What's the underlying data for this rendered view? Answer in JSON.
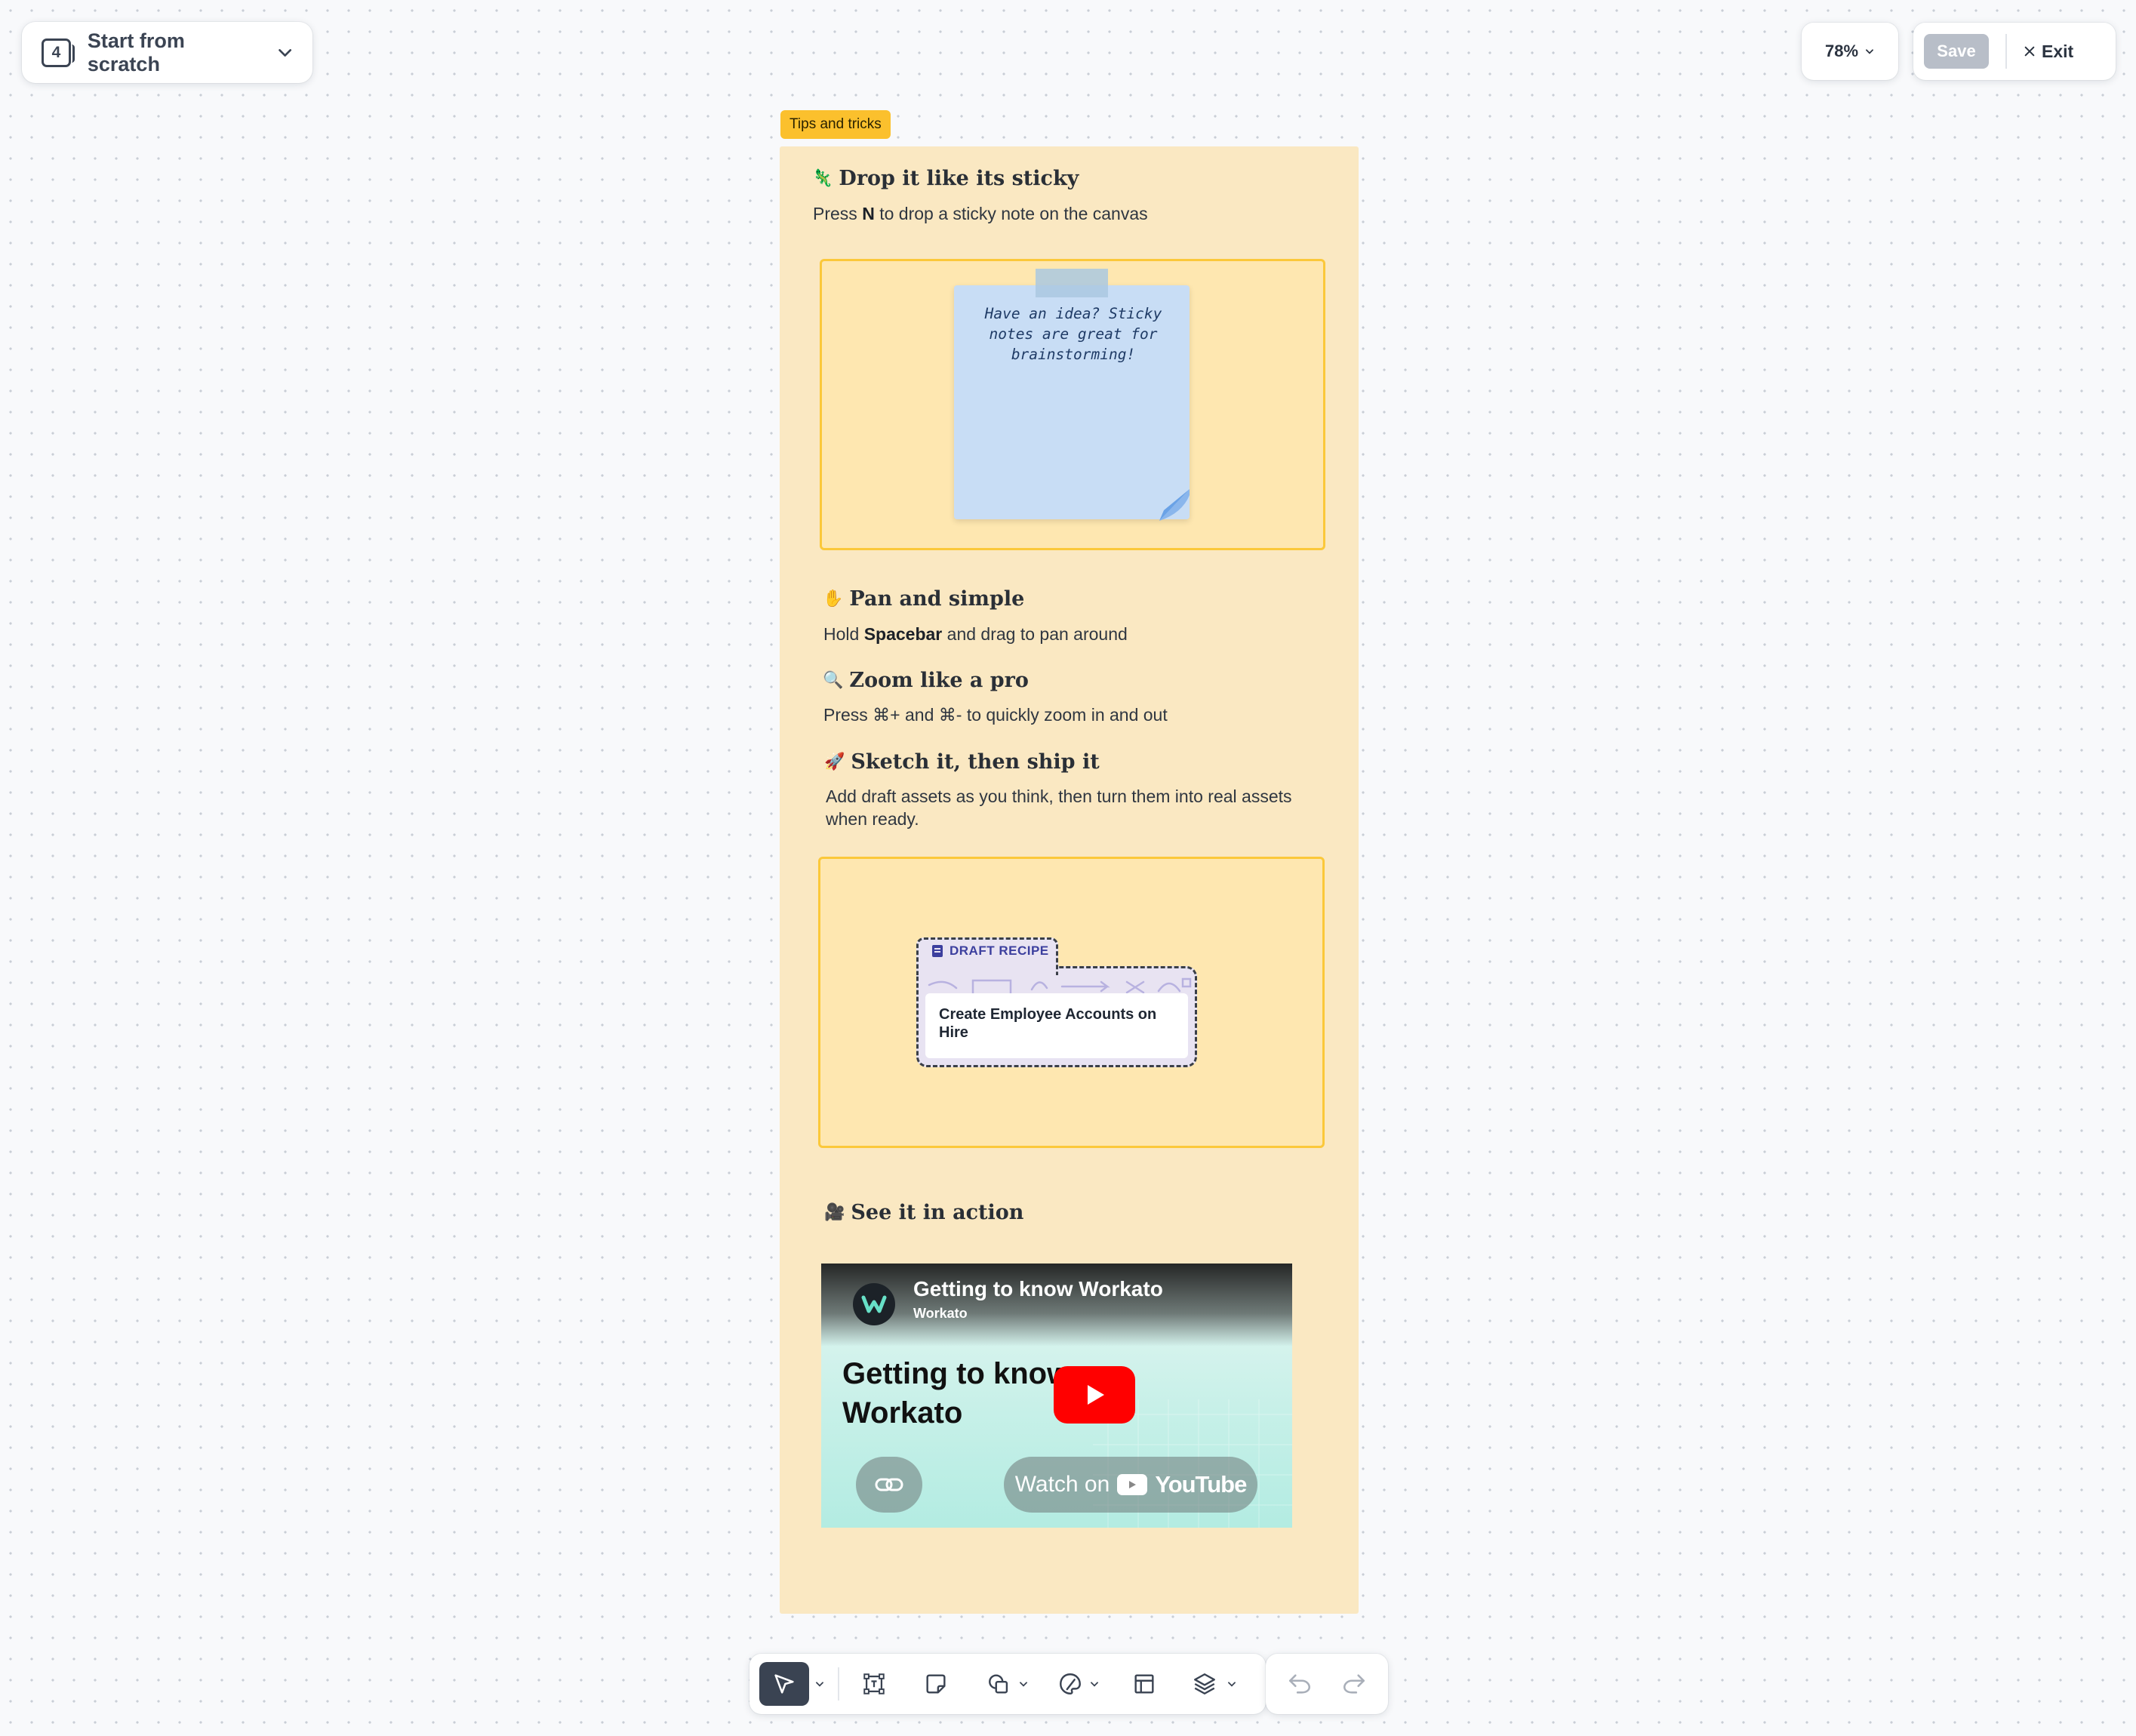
{
  "header": {
    "scope_badge": "4",
    "scope_label": "Start from scratch",
    "zoom_label": "78%",
    "save_label": "Save",
    "exit_label": "Exit"
  },
  "note": {
    "tag": "Tips and tricks",
    "sections": [
      {
        "emoji": "🦎",
        "title": "Drop it like its sticky",
        "desc_pre": "Press ",
        "desc_key": "N",
        "desc_post": " to drop a sticky note on the canvas"
      },
      {
        "emoji": "✋",
        "title": "Pan and simple",
        "desc_pre": "Hold ",
        "desc_key": "Spacebar",
        "desc_post": " and drag to pan around"
      },
      {
        "emoji": "🔍",
        "title": "Zoom like a pro",
        "desc": "Press ⌘+ and ⌘- to quickly zoom in and out"
      },
      {
        "emoji": "🚀",
        "title": "Sketch it, then ship it",
        "desc": "Add draft assets as you think, then turn them into real assets when ready."
      },
      {
        "emoji": "🎥",
        "title": "See it in action"
      }
    ],
    "sticky_text": "Have an idea? Sticky notes are great for brainstorming!",
    "draft": {
      "tab_label": "DRAFT RECIPE",
      "name": "Create Employee Accounts on Hire"
    },
    "video": {
      "title": "Getting to know Workato",
      "channel": "Workato",
      "big_text": "Getting to know Workato",
      "watch_label": "Watch on",
      "youtube_word": "YouTube"
    }
  },
  "toolbar": {
    "tools": [
      "select-tool",
      "text-frame-tool",
      "sticky-note-tool",
      "shapes-tool",
      "draw-tool",
      "frame-tool",
      "layers-tool"
    ],
    "active": "select-tool"
  },
  "colors": {
    "canvas": "#f8f9fb",
    "note_bg": "#fae8c2",
    "tag_bg": "#fbc02d",
    "frame_border": "#fbc83a",
    "sticky_bg": "#c8ddf5",
    "draft_label": "#3c3f9e",
    "youtube_red": "#ff0000",
    "active_tool_bg": "#3a4352"
  }
}
